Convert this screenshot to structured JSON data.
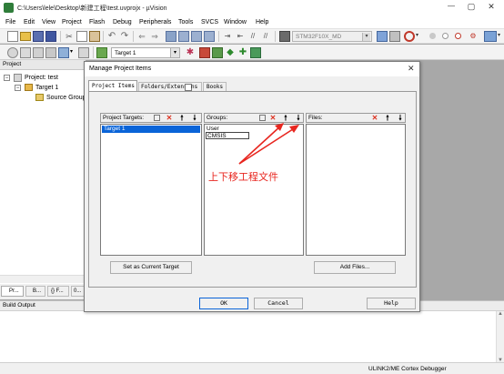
{
  "window": {
    "title": "C:\\Users\\lele\\Desktop\\新建工程\\test.uvprojx - µVision",
    "controls": [
      "—",
      "▢",
      "✕"
    ]
  },
  "menubar": [
    "File",
    "Edit",
    "View",
    "Project",
    "Flash",
    "Debug",
    "Peripherals",
    "Tools",
    "SVCS",
    "Window",
    "Help"
  ],
  "toolbar": {
    "device": "STM32F10X_MD",
    "target": "Target 1"
  },
  "project_pane": {
    "title": "Project",
    "root": "Project: test",
    "target": "Target 1",
    "group": "Source Group",
    "tabs": [
      "Pr...",
      "B...",
      "{} F...",
      "0..."
    ]
  },
  "build_output": {
    "title": "Build Output"
  },
  "statusbar": {
    "debugger": "ULINK2/ME Cortex Debugger"
  },
  "dialog": {
    "title": "Manage Project Items",
    "tabs": [
      "Project Items",
      "Folders/Extens",
      "ns",
      "Books"
    ],
    "targets_label": "Project Targets:",
    "targets": [
      "Target 1"
    ],
    "groups_label": "Groups:",
    "groups": [
      "User",
      "CMSIS"
    ],
    "files_label": "Files:",
    "set_current_button": "Set as Current Target",
    "add_files_button": "Add Files...",
    "ok_button": "OK",
    "cancel_button": "Cancel",
    "help_button": "Help"
  },
  "annotation": {
    "text": "上下移工程文件",
    "color": "#e8261f"
  }
}
